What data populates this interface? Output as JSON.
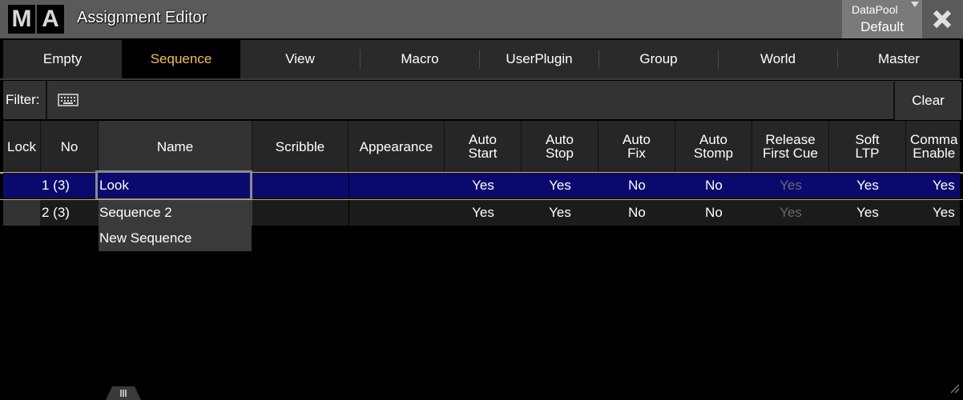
{
  "window": {
    "logo": [
      "M",
      "A"
    ],
    "title": "Assignment Editor",
    "datapool": {
      "label": "DataPool",
      "value": "Default"
    },
    "close_icon": "close-x-icon"
  },
  "tabs": [
    {
      "label": "Empty",
      "active": false
    },
    {
      "label": "Sequence",
      "active": true
    },
    {
      "label": "View",
      "active": false
    },
    {
      "label": "Macro",
      "active": false
    },
    {
      "label": "UserPlugin",
      "active": false
    },
    {
      "label": "Group",
      "active": false
    },
    {
      "label": "World",
      "active": false
    },
    {
      "label": "Master",
      "active": false
    }
  ],
  "filter": {
    "label": "Filter:",
    "value": "",
    "keyboard_icon": "keyboard-icon",
    "clear_label": "Clear"
  },
  "columns": [
    "Lock",
    "No",
    "Name",
    "Scribble",
    "Appearance",
    "Auto\nStart",
    "Auto\nStop",
    "Auto\nFix",
    "Auto\nStomp",
    "Release\nFirst Cue",
    "Soft\nLTP",
    "Comma\nEnable"
  ],
  "rows": [
    {
      "lock": "",
      "no": "1 (3)",
      "name": "Look",
      "scribble": "",
      "appearance": "",
      "auto_start": "Yes",
      "auto_stop": "Yes",
      "auto_fix": "No",
      "auto_stomp": "No",
      "release_first_cue": "Yes",
      "soft_ltp": "Yes",
      "command_enable": "Yes"
    },
    {
      "lock": "",
      "no": "2 (3)",
      "name": "Sequence 2",
      "scribble": "",
      "appearance": "",
      "auto_start": "Yes",
      "auto_stop": "Yes",
      "auto_fix": "No",
      "auto_stomp": "No",
      "release_first_cue": "Yes",
      "soft_ltp": "Yes",
      "command_enable": "Yes"
    }
  ],
  "new_row_label": "New Sequence",
  "colors": {
    "accent": "#f2c23c",
    "selection": "#0a0a6e",
    "row_line": "#c6b03a"
  }
}
